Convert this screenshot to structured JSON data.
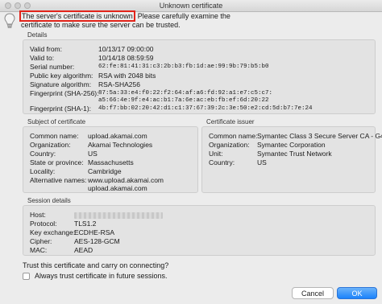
{
  "window": {
    "title": "Unknown certificate"
  },
  "header": {
    "highlighted_text": "The server's certificate is unknown",
    "text_line1_rest": ". Please carefully examine the",
    "text_line2": "certificate to make sure the server can be trusted."
  },
  "details": {
    "label": "Details",
    "rows": [
      {
        "label": "Valid from:",
        "value": "10/13/17 09:00:00"
      },
      {
        "label": "Valid to:",
        "value": "10/14/18 08:59:59"
      },
      {
        "label": "Serial number:",
        "value": "62:fe:81:41:31:c3:2b:b3:fb:1d:ae:99:9b:79:b5:b0"
      },
      {
        "label": "Public key algorithm:",
        "value": "RSA with 2048 bits"
      },
      {
        "label": "Signature algorithm:",
        "value": "RSA-SHA256"
      },
      {
        "label": "Fingerprint (SHA-256):",
        "value": "87:5a:33:e4:f0:22:f2:64:af:a6:fd:92:a1:e7:c5:c7:",
        "value2": "a5:66:4e:9f:e4:ac:b1:7a:6e:ac:eb:fb:ef:6d:20:22"
      },
      {
        "label": "Fingerprint (SHA-1):",
        "value": "4b:f7:bb:02:20:42:d1:c1:37:67:39:2c:3e:50:e2:cd:5d:b7:7e:24"
      }
    ]
  },
  "subject": {
    "label": "Subject of certificate",
    "rows": [
      {
        "label": "Common name:",
        "value": "upload.akamai.com"
      },
      {
        "label": "Organization:",
        "value": "Akamai Technologies"
      },
      {
        "label": "Country:",
        "value": "US"
      },
      {
        "label": "State or province:",
        "value": "Massachusetts"
      },
      {
        "label": "Locality:",
        "value": "Cambridge"
      },
      {
        "label": "Alternative names:",
        "value": "www.upload.akamai.com",
        "value2": "upload.akamai.com"
      }
    ]
  },
  "issuer": {
    "label": "Certificate issuer",
    "rows": [
      {
        "label": "Common name:",
        "value": "Symantec Class 3 Secure Server CA - G4"
      },
      {
        "label": "Organization:",
        "value": "Symantec Corporation"
      },
      {
        "label": "Unit:",
        "value": "Symantec Trust Network"
      },
      {
        "label": "Country:",
        "value": "US"
      }
    ]
  },
  "session": {
    "label": "Session details",
    "rows": [
      {
        "label": "Host:",
        "value": ""
      },
      {
        "label": "Protocol:",
        "value": "TLS1.2"
      },
      {
        "label": "Key exchange:",
        "value": "ECDHE-RSA"
      },
      {
        "label": "Cipher:",
        "value": "AES-128-GCM"
      },
      {
        "label": "MAC:",
        "value": "AEAD"
      }
    ]
  },
  "footer": {
    "question": "Trust this certificate and carry on connecting?",
    "checkbox_label": "Always trust certificate in future sessions.",
    "checkbox_checked": false,
    "cancel_label": "Cancel",
    "ok_label": "OK"
  },
  "colors": {
    "highlight": "#e2231a",
    "ok_button": "#1a82fb"
  }
}
